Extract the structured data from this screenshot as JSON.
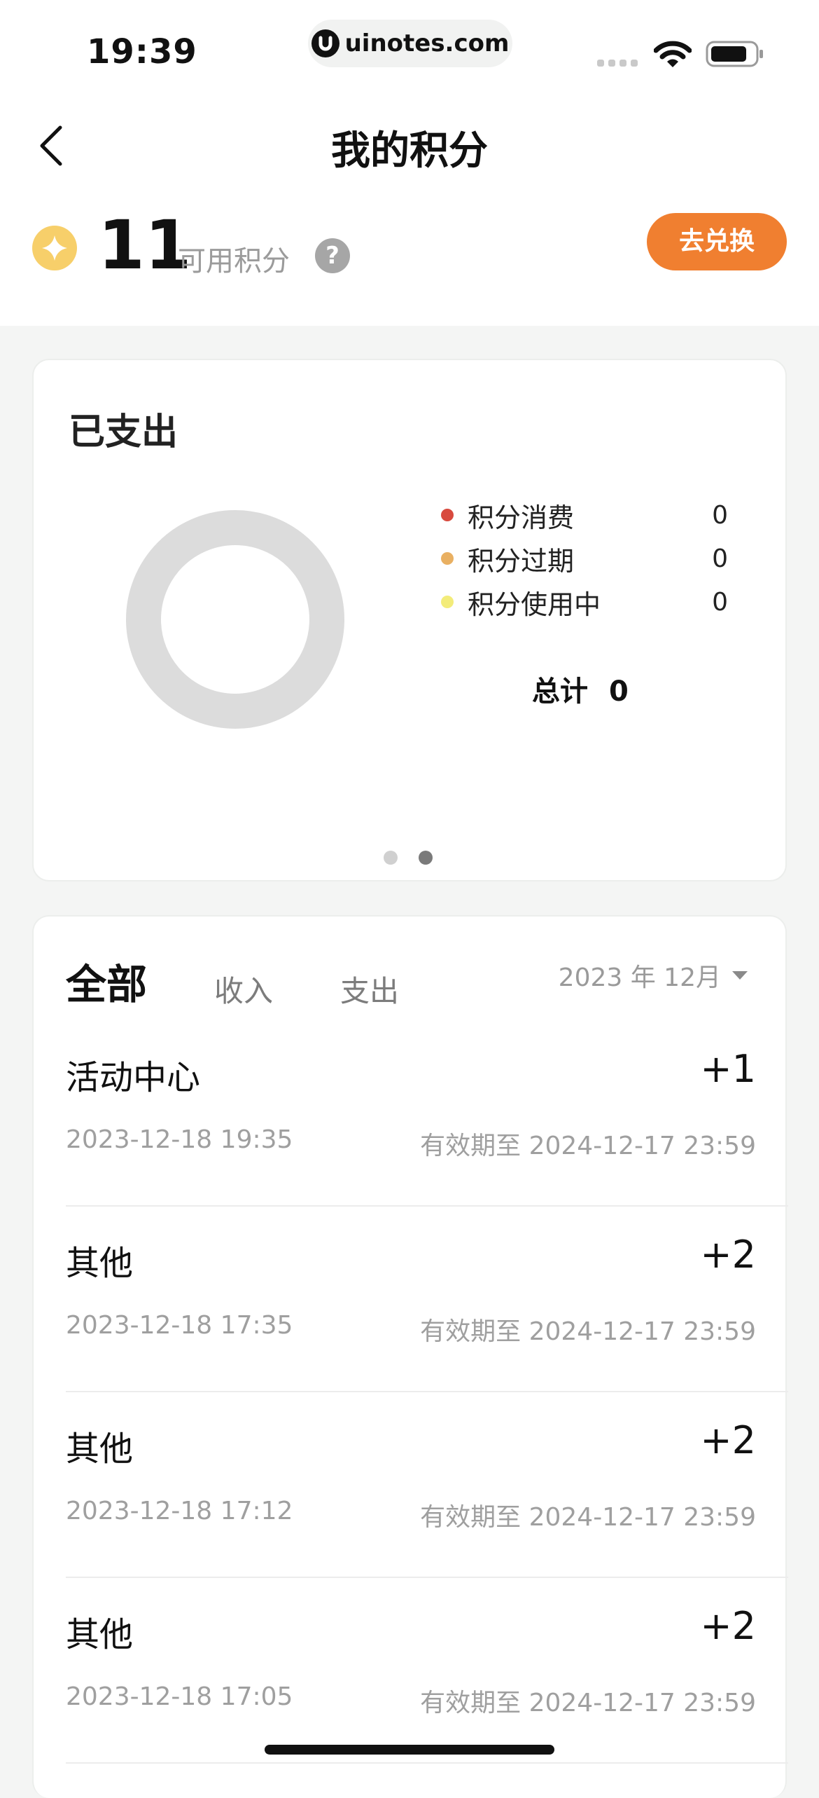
{
  "status_bar": {
    "time": "19:39",
    "url": "uinotes.com"
  },
  "header": {
    "title": "我的积分",
    "back_icon": "chevron-left-icon"
  },
  "points": {
    "value": "11",
    "label": "可用积分",
    "help": "?",
    "exchange_label": "去兑换",
    "accent": "#f07f30",
    "coin_color": "#f7cf6a"
  },
  "spend_card": {
    "title": "已支出",
    "legend": [
      {
        "label": "积分消费",
        "value": "0",
        "color": "#d84a3e"
      },
      {
        "label": "积分过期",
        "value": "0",
        "color": "#e9b062"
      },
      {
        "label": "积分使用中",
        "value": "0",
        "color": "#f3ec7a"
      }
    ],
    "total_label": "总计",
    "total_value": "0",
    "donut_color": "#dcdcdc",
    "pager": {
      "count": 2,
      "active_index": 1
    }
  },
  "records_card": {
    "tabs": [
      "全部",
      "收入",
      "支出"
    ],
    "active_tab": 0,
    "month": "2023 年 12月",
    "items": [
      {
        "name": "活动中心",
        "amount": "+1",
        "time": "2023-12-18 19:35",
        "expiry": "有效期至 2024-12-17 23:59"
      },
      {
        "name": "其他",
        "amount": "+2",
        "time": "2023-12-18 17:35",
        "expiry": "有效期至 2024-12-17 23:59"
      },
      {
        "name": "其他",
        "amount": "+2",
        "time": "2023-12-18 17:12",
        "expiry": "有效期至 2024-12-17 23:59"
      },
      {
        "name": "其他",
        "amount": "+2",
        "time": "2023-12-18 17:05",
        "expiry": "有效期至 2024-12-17 23:59"
      }
    ]
  }
}
